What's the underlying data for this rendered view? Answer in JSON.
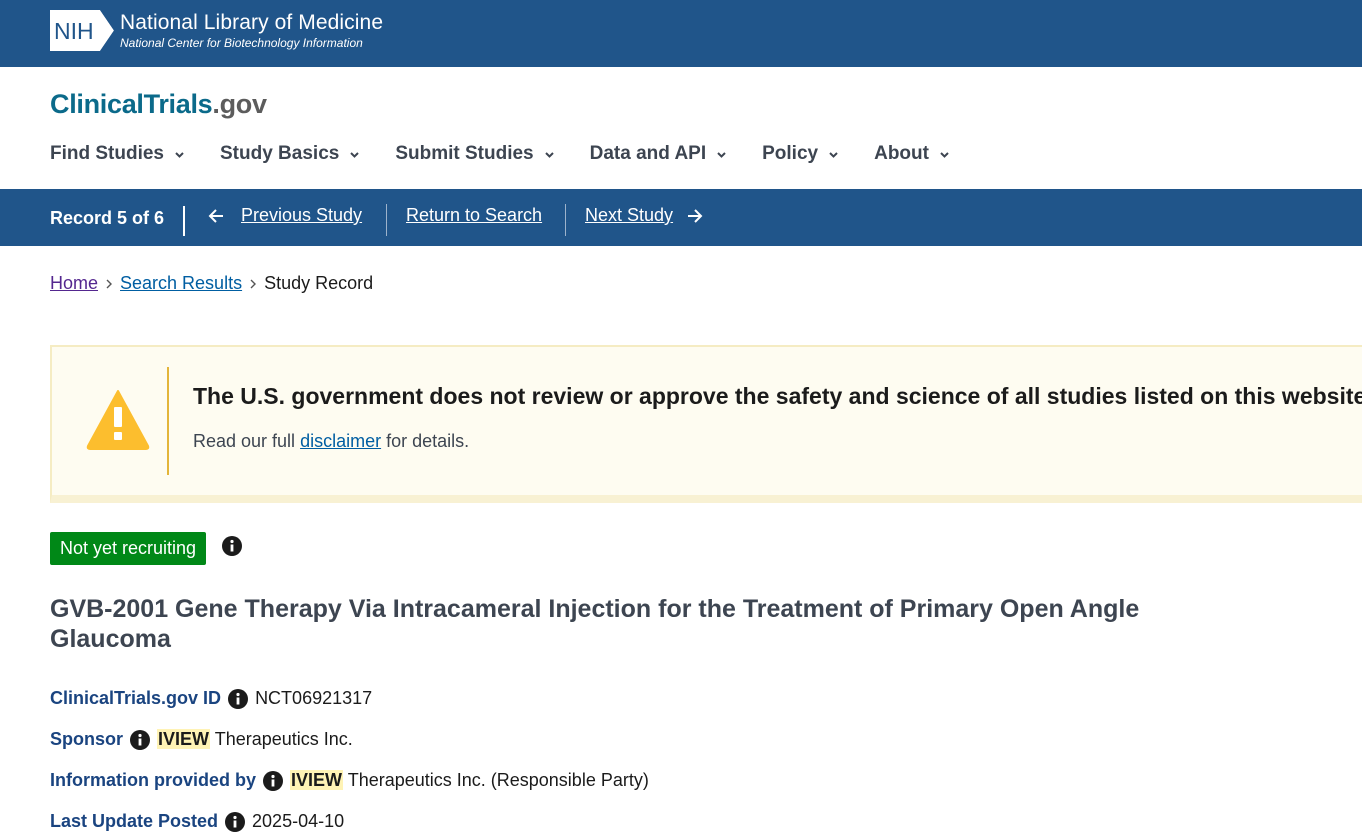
{
  "nih": {
    "badge": "NIH",
    "title": "National Library of Medicine",
    "subtitle": "National Center for Biotechnology Information"
  },
  "site": {
    "brand": "ClinicalTrials",
    "tld": ".gov"
  },
  "nav": {
    "items": [
      {
        "label": "Find Studies"
      },
      {
        "label": "Study Basics"
      },
      {
        "label": "Submit Studies"
      },
      {
        "label": "Data and API"
      },
      {
        "label": "Policy"
      },
      {
        "label": "About"
      }
    ]
  },
  "record_bar": {
    "record_count": "Record 5 of 6",
    "previous": "Previous Study",
    "return": "Return to Search",
    "next": "Next Study"
  },
  "breadcrumb": {
    "home": "Home",
    "search": "Search Results",
    "current": "Study Record"
  },
  "warning": {
    "title": "The U.S. government does not review or approve the safety and science of all studies listed on this website.",
    "body_prefix": "Read our full ",
    "link": "disclaimer",
    "body_suffix": " for details."
  },
  "status": {
    "label": "Not yet recruiting",
    "color": "#008817"
  },
  "study": {
    "title": "GVB-2001 Gene Therapy Via Intracameral Injection for the Treatment of Primary Open Angle Glaucoma",
    "id_label": "ClinicalTrials.gov ID",
    "id_value": "NCT06921317",
    "sponsor_label": "Sponsor",
    "sponsor_highlight": "IVIEW",
    "sponsor_rest": " Therapeutics Inc.",
    "info_label": "Information provided by",
    "info_highlight": "IVIEW",
    "info_rest": " Therapeutics Inc. (Responsible Party)",
    "updated_label": "Last Update Posted",
    "updated_value": "2025-04-10"
  },
  "colors": {
    "header_blue": "#20558a",
    "brand_teal": "#0b6a8a",
    "label_navy": "#1a4480",
    "link_blue": "#005ea2",
    "warning_yellow": "#fcbe2e",
    "highlight": "#fff3b5"
  }
}
